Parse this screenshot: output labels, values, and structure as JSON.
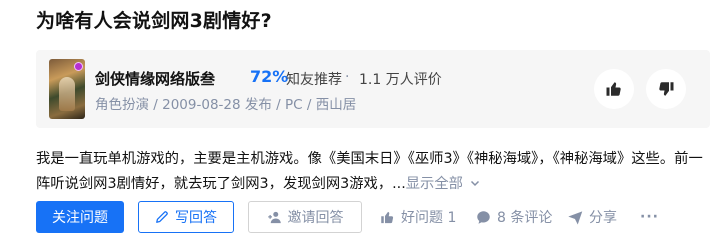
{
  "question": {
    "title": "为啥有人会说剑网3剧情好?"
  },
  "game_card": {
    "name": "剑侠情缘网络版叁",
    "recommend_percent": "72%",
    "recommend_label": "知友推荐",
    "separator": "·",
    "rating_count": "1.1 万人评价",
    "meta": "角色扮演 / 2009-08-28 发布 / PC / 西山居",
    "like_icon": "thumbs-up-icon",
    "dislike_icon": "thumbs-down-icon"
  },
  "answer": {
    "excerpt": "我是一直玩单机游戏的，主要是主机游戏。像《美国末日》《巫师3》《神秘海域》，《神秘海域》这些。前一阵听说剑网3剧情好，就去玩了剑网3，发现剑网3游戏，...",
    "show_all": "显示全部",
    "show_all_icon": "chevron-down-icon"
  },
  "actions": {
    "follow_label": "关注问题",
    "write_answer_label": "写回答",
    "invite_label": "邀请回答",
    "good_question_label": "好问题 1",
    "comments_label": "8 条评论",
    "share_label": "分享",
    "more_label": "···"
  },
  "colors": {
    "accent": "#1772f6",
    "muted": "#8590a6",
    "card_bg": "#f6f6f6"
  }
}
